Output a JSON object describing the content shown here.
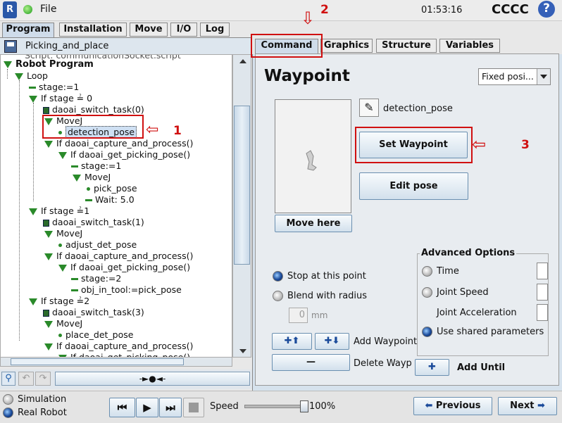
{
  "topbar": {
    "file_label": "File",
    "time": "01:53:16",
    "robot_name": "CCCC",
    "help": "?"
  },
  "main_tabs": [
    "Program",
    "Installation",
    "Move",
    "I/O",
    "Log"
  ],
  "program_name": "Picking_and_place",
  "tree": {
    "partial_top": "Script: communicationSocket.script",
    "root": "Robot Program",
    "items": [
      "Loop",
      "stage:=1",
      "If stage ≟ 0",
      "daoai_switch_task(0)",
      "MoveJ",
      "detection_pose",
      "If daoai_capture_and_process()",
      "If daoai_get_picking_pose()",
      "stage:=1",
      "MoveJ",
      "pick_pose",
      "Wait: 5.0",
      "If stage ≟1",
      "daoai_switch_task(1)",
      "MoveJ",
      "adjust_det_pose",
      "If daoai_capture_and_process()",
      "If daoai_get_picking_pose()",
      "stage:=2",
      "obj_in_tool:=pick_pose",
      "If stage ≟2",
      "daoai_switch_task(3)",
      "MoveJ",
      "place_det_pose",
      "If daoai_capture_and_process()",
      "If daoai_get_picking_pose()"
    ]
  },
  "right_tabs": [
    "Command",
    "Graphics",
    "Structure",
    "Variables"
  ],
  "waypoint": {
    "title": "Waypoint",
    "type_select": "Fixed posi...",
    "name": "detection_pose",
    "move_here": "Move here",
    "set_waypoint": "Set Waypoint",
    "edit_pose": "Edit pose"
  },
  "advanced": {
    "title": "Advanced Options",
    "time": "Time",
    "joint_speed": "Joint Speed",
    "joint_acc": "Joint Acceleration",
    "use_shared": "Use shared parameters"
  },
  "stop_at_point": "Stop at this point",
  "blend_with_radius": "Blend with radius",
  "blend_value": "0",
  "blend_unit": "mm",
  "add_waypoint": "Add Waypoint",
  "delete_waypoint": "Delete Wayp",
  "add_until": "Add Until",
  "bottom": {
    "simulation": "Simulation",
    "real_robot": "Real Robot",
    "speed_label": "Speed",
    "speed_value": "100%",
    "previous": "Previous",
    "next": "Next"
  },
  "annotations": {
    "n1": "1",
    "n2": "2",
    "n3": "3"
  },
  "colors": {
    "annotation": "#d01010",
    "tree_green": "#2a8a2a",
    "tab_active": "#cfdcea"
  }
}
